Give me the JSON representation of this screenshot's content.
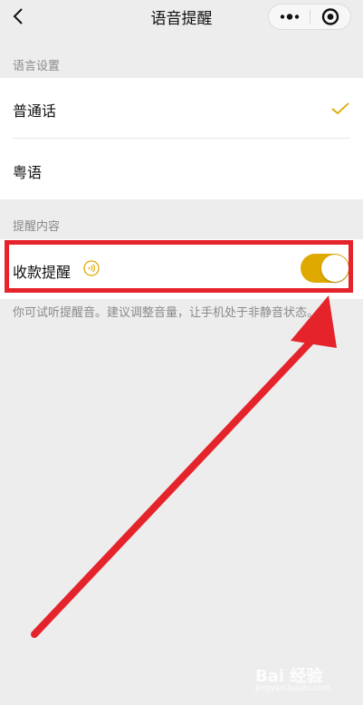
{
  "nav": {
    "title": "语音提醒",
    "back_icon": "chevron-left-icon",
    "more_icon": "more-dots-icon",
    "close_icon": "target-close-icon"
  },
  "language_section": {
    "header": "语言设置",
    "options": [
      {
        "label": "普通话",
        "selected": true
      },
      {
        "label": "粤语",
        "selected": false
      }
    ]
  },
  "content_section": {
    "header": "提醒内容",
    "payment_reminder": {
      "label": "收款提醒",
      "icon": "sound-wave-icon",
      "enabled": true
    },
    "hint": "你可试听提醒音。建议调整音量，让手机处于非静音状态。"
  },
  "colors": {
    "accent": "#e0a900",
    "annotation": "#e5232b",
    "background": "#ededed"
  },
  "watermark": {
    "text": "Bai 经验",
    "sub": "jingyan.baidu.com"
  }
}
